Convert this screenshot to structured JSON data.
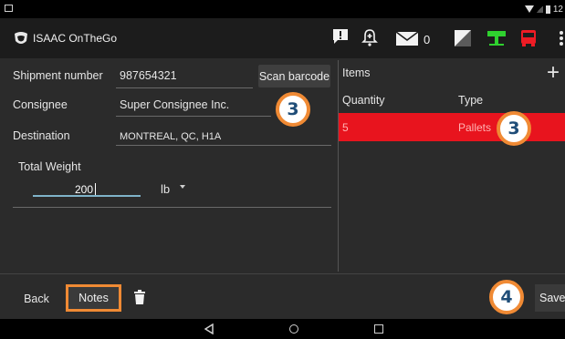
{
  "app": {
    "title": "ISAAC OnTheGo"
  },
  "status_bar": {
    "time": "12"
  },
  "toolbar": {
    "mail_count": "0"
  },
  "form": {
    "shipment_number": {
      "label": "Shipment number",
      "value": "987654321"
    },
    "scan_barcode_label": "Scan barcode",
    "consignee": {
      "label": "Consignee",
      "value": "Super Consignee Inc."
    },
    "destination": {
      "label": "Destination",
      "value": "MONTREAL, QC, H1A"
    },
    "total_weight": {
      "label": "Total Weight",
      "value": "200",
      "unit": "lb"
    }
  },
  "items_panel": {
    "title": "Items",
    "add_label": "+",
    "columns": [
      "Quantity",
      "Type"
    ],
    "rows": [
      {
        "quantity": "5",
        "type": "Pallets"
      }
    ]
  },
  "bottom": {
    "back_label": "Back",
    "notes_label": "Notes",
    "save_label": "Save"
  },
  "badges": {
    "scan": "3",
    "items": "3",
    "save": "4"
  },
  "colors": {
    "accent": "#f08a34",
    "selected_row": "#e8141e",
    "badge_text": "#1f4d78"
  }
}
